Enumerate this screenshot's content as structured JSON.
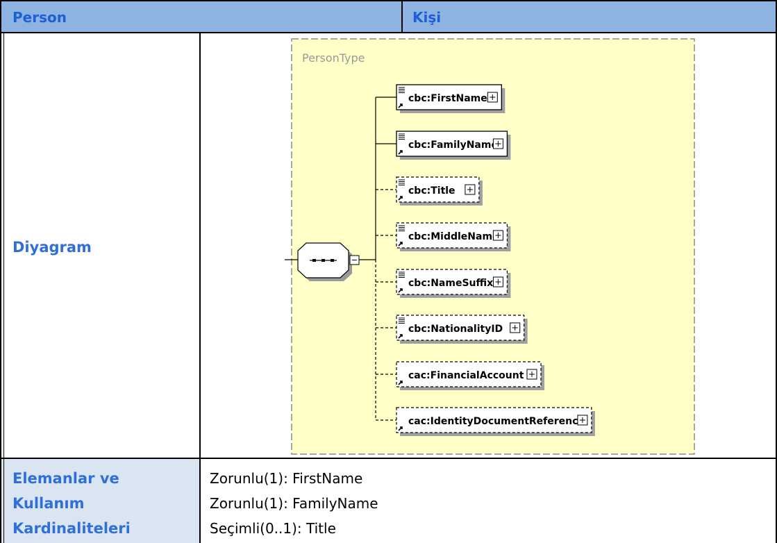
{
  "header": {
    "left": "Person",
    "right": "Kişi"
  },
  "rows": {
    "diagram_label": "Diyagram",
    "elements_label_lines": [
      "Elemanlar ve",
      "Kullanım",
      "Kardinaliteleri"
    ],
    "elements_values": [
      "Zorunlu(1): FirstName",
      "Zorunlu(1): FamilyName",
      "Seçimli(0..1): Title"
    ]
  },
  "diagram": {
    "type_name": "PersonType",
    "elements": [
      {
        "name": "cbc:FirstName",
        "required": true,
        "has_lines_icon": true
      },
      {
        "name": "cbc:FamilyName",
        "required": true,
        "has_lines_icon": true
      },
      {
        "name": "cbc:Title",
        "required": false,
        "has_lines_icon": true
      },
      {
        "name": "cbc:MiddleName",
        "required": false,
        "has_lines_icon": true
      },
      {
        "name": "cbc:NameSuffix",
        "required": false,
        "has_lines_icon": true
      },
      {
        "name": "cbc:NationalityID",
        "required": false,
        "has_lines_icon": true
      },
      {
        "name": "cac:FinancialAccount",
        "required": false,
        "has_lines_icon": false
      },
      {
        "name": "cac:IdentityDocumentReference",
        "required": false,
        "has_lines_icon": false
      }
    ],
    "colors": {
      "panel_bg": "#ffffc8",
      "panel_border": "#8a8a8a",
      "type_label": "#999999",
      "header_bg": "#8db3e2",
      "header_text": "#1f5fd6",
      "label_bg": "#dbe5f1",
      "label_text": "#2f6fd8"
    }
  }
}
